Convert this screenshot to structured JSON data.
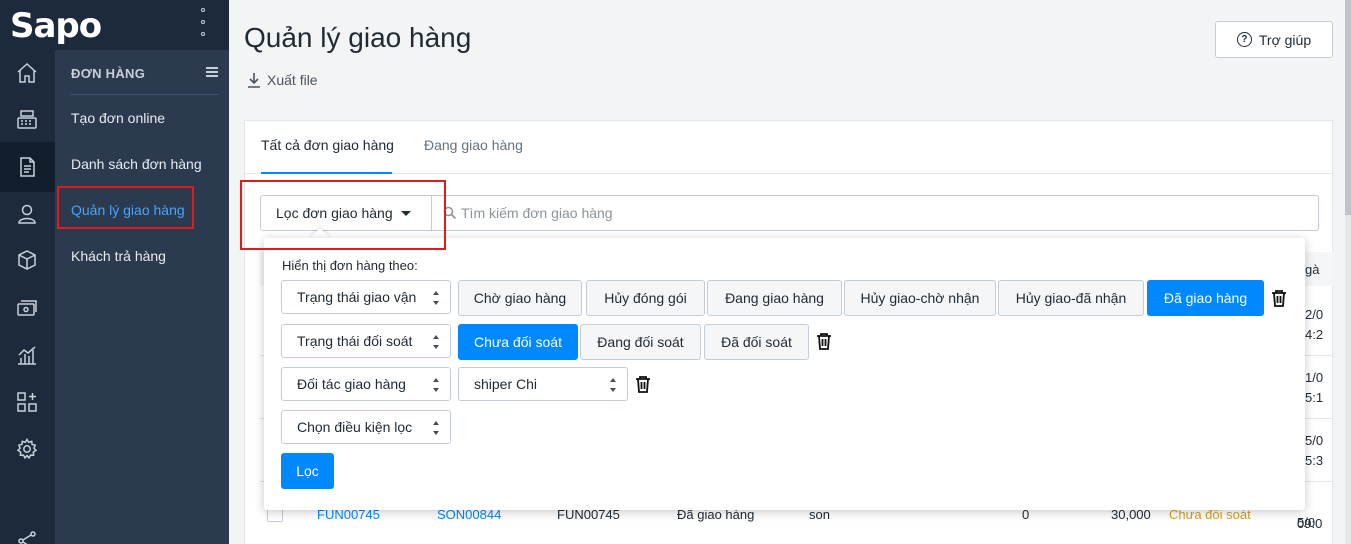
{
  "brand": {
    "logo": "Sapo"
  },
  "rail": {
    "icons": [
      "home-icon",
      "cash-register-icon",
      "orders-icon",
      "customer-icon",
      "product-box-icon",
      "cashbook-icon",
      "report-chart-icon",
      "apps-icon",
      "settings-icon",
      "share-icon"
    ]
  },
  "submenu": {
    "heading": "ĐƠN HÀNG",
    "items": [
      {
        "label": "Tạo đơn online"
      },
      {
        "label": "Danh sách đơn hàng"
      },
      {
        "label": "Quản lý giao hàng"
      },
      {
        "label": "Khách trả hàng"
      }
    ]
  },
  "header": {
    "title": "Quản lý giao hàng",
    "export_label": "Xuất file",
    "help_label": "Trợ giúp"
  },
  "tabs": [
    {
      "label": "Tất cả đơn giao hàng"
    },
    {
      "label": "Đang giao hàng"
    }
  ],
  "filter": {
    "button_label": "Lọc đơn giao hàng",
    "search_placeholder": "Tìm kiếm đơn giao hàng"
  },
  "popover": {
    "title": "Hiển thị đơn hàng theo:",
    "row1": {
      "select": "Trạng thái giao vận",
      "options": [
        "Chờ giao hàng",
        "Hủy đóng gói",
        "Đang giao hàng",
        "Hủy giao-chờ nhận",
        "Hủy giao-đã nhận",
        "Đã giao hàng"
      ],
      "selected": "Đã giao hàng"
    },
    "row2": {
      "select": "Trạng thái đối soát",
      "options": [
        "Chưa đối soát",
        "Đang đối soát",
        "Đã đối soát"
      ],
      "selected": "Chưa đối soát"
    },
    "row3": {
      "select": "Đối tác giao hàng",
      "partner": "shiper Chi"
    },
    "row4": {
      "select": "Chọn điều kiện lọc"
    },
    "apply_label": "Lọc"
  },
  "table_peek": {
    "right_header": "gà",
    "right_cells": [
      "2/0",
      "4:2",
      "1/0",
      "5:1",
      "5/0",
      "5:3",
      "5/0",
      "09:0"
    ],
    "last_row": {
      "code": "FUN00745",
      "order": "SON00844",
      "tracking": "FUN00745",
      "status": "Đã giao hàng",
      "partner": "son",
      "cod": "0",
      "fee": "30,000",
      "reconcile": "Chưa đối soát"
    }
  },
  "colors": {
    "accent": "#0088ff",
    "sidebar": "#2b3a4e",
    "rail": "#1d2a3b",
    "highlight": "#e01b1b"
  }
}
